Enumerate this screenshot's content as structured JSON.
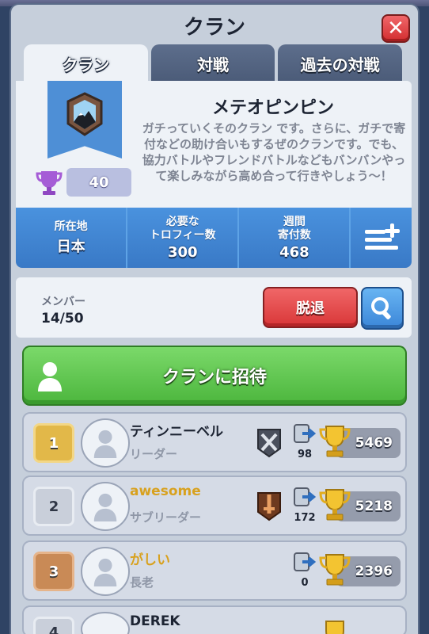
{
  "header": {
    "title": "クラン",
    "close_label": "✕"
  },
  "tabs": [
    {
      "label": "クラン",
      "active": true
    },
    {
      "label": "対戦",
      "active": false
    },
    {
      "label": "過去の対戦",
      "active": false
    }
  ],
  "clan": {
    "name": "メテオピンピン",
    "description": "ガチっていくそのクラン です。さらに、ガチで寄付などの助け合いもするぜのクランです。でも、協力バトルやフレンドバトルなどもバンバンやって楽しみながら高め合って行きやしょう～！",
    "trophies": "40",
    "badge_color": "#4e8fd6"
  },
  "stats": [
    {
      "label": "所在地",
      "value": "日本"
    },
    {
      "label": "必要な\nトロフィー数",
      "value": "300"
    },
    {
      "label": "週間\n寄付数",
      "value": "468"
    }
  ],
  "members_section": {
    "label": "メンバー",
    "count": "14/50",
    "leave_label": "脱退",
    "search_icon": "search-icon"
  },
  "invite": {
    "label": "クランに招待"
  },
  "members": [
    {
      "rank": "1",
      "name": "ティンニーベル",
      "role": "リーダー",
      "arena": "silver-swords",
      "donations": "98",
      "trophies": "5469",
      "name_color": "#1d2433"
    },
    {
      "rank": "2",
      "name": "awesome",
      "role": "サブリーダー",
      "arena": "bronze-sword",
      "donations": "172",
      "trophies": "5218",
      "name_color": "#d8a11e"
    },
    {
      "rank": "3",
      "name": "がしい",
      "role": "長老",
      "arena": "",
      "donations": "0",
      "trophies": "2396",
      "name_color": "#d8a11e"
    },
    {
      "rank": "4",
      "name": "DEREK",
      "role": "",
      "arena": "",
      "donations": "",
      "trophies": "",
      "name_color": "#1d2433"
    }
  ]
}
